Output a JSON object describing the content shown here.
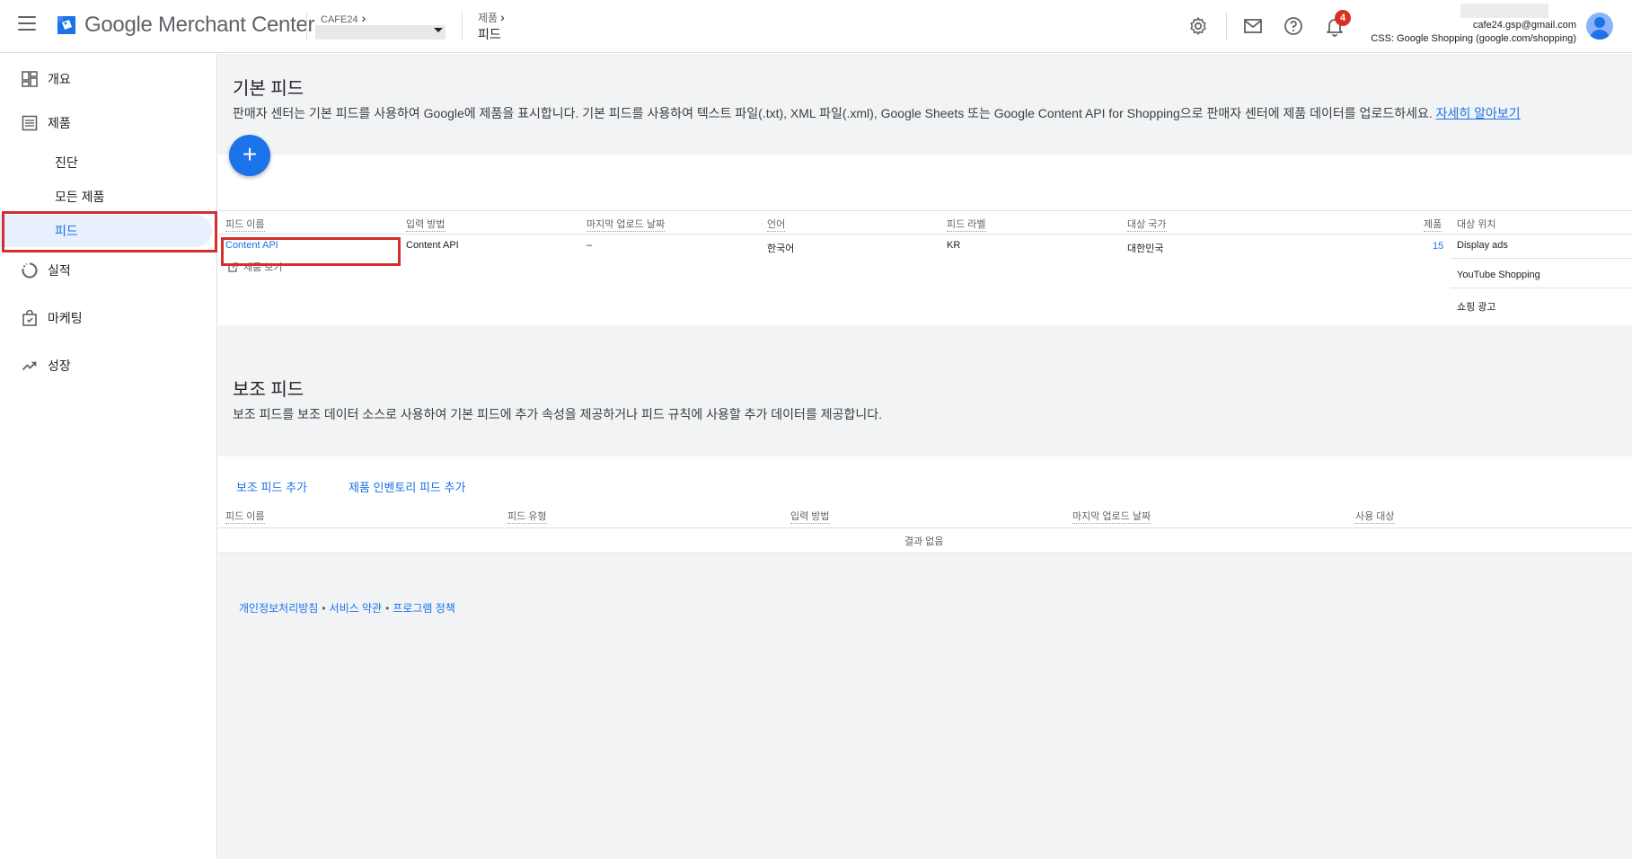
{
  "header": {
    "app_name": "Google Merchant Center",
    "account_label": "CAFE24",
    "breadcrumb_parent": "제품",
    "breadcrumb_current": "피드",
    "notification_count": "4",
    "user_email": "cafe24.gsp@gmail.com",
    "css_label": "CSS: Google Shopping (google.com/shopping)",
    "icons": [
      "settings-icon",
      "mail-icon",
      "help-icon",
      "notifications-icon"
    ]
  },
  "sidebar": {
    "items": [
      {
        "label": "개요",
        "icon": "overview-icon"
      },
      {
        "label": "제품",
        "icon": "products-icon"
      },
      {
        "label": "진단"
      },
      {
        "label": "모든 제품"
      },
      {
        "label": "피드"
      },
      {
        "label": "실적",
        "icon": "performance-icon"
      },
      {
        "label": "마케팅",
        "icon": "marketing-icon"
      },
      {
        "label": "성장",
        "icon": "growth-icon"
      }
    ],
    "active_item": "피드"
  },
  "primary_feeds": {
    "title": "기본 피드",
    "description": "판매자 센터는 기본 피드를 사용하여 Google에 제품을 표시합니다. 기본 피드를 사용하여 텍스트 파일(.txt), XML 파일(.xml), Google Sheets 또는 Google Content API for Shopping으로 판매자 센터에 제품 데이터를 업로드하세요.",
    "learn_more": "자세히 알아보기",
    "add_button": "+",
    "columns": [
      "피드 이름",
      "입력 방법",
      "마지막 업로드 날짜",
      "언어",
      "피드 라벨",
      "대상 국가",
      "제품",
      "대상 위치"
    ],
    "rows": [
      {
        "feed_name": "Content API",
        "input_method": "Content API",
        "last_upload": "–",
        "language": "한국어",
        "feed_label": "KR",
        "country": "대한민국",
        "products": "15",
        "destinations": [
          "Display ads",
          "YouTube Shopping",
          "쇼핑 광고"
        ]
      }
    ],
    "view_products": "제품 보기"
  },
  "supplemental_feeds": {
    "title": "보조 피드",
    "description": "보조 피드를 보조 데이터 소스로 사용하여 기본 피드에 추가 속성을 제공하거나 피드 규칙에 사용할 추가 데이터를 제공합니다.",
    "add_supplemental": "보조 피드 추가",
    "add_inventory": "제품 인벤토리 피드 추가",
    "columns": [
      "피드 이름",
      "피드 유형",
      "입력 방법",
      "마지막 업로드 날짜",
      "사용 대상"
    ],
    "empty_text": "결과 없음"
  },
  "footer": {
    "links": [
      "개인정보처리방침",
      "서비스 약관",
      "프로그램 정책"
    ],
    "separator": "•"
  }
}
